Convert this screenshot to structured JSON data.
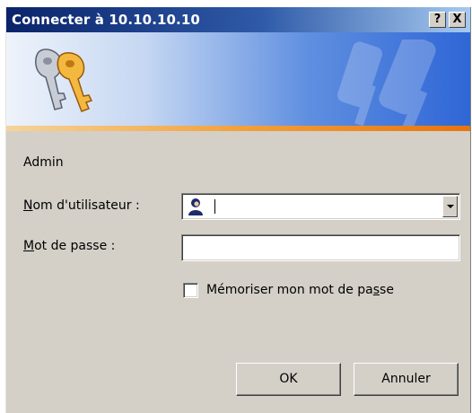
{
  "window": {
    "title": "Connecter à 10.10.10.10",
    "help_label": "?",
    "close_label": "X"
  },
  "banner": {
    "icon": "keys-icon",
    "watermark_icon": "keys-watermark-icon"
  },
  "realm_text": "Admin",
  "username": {
    "label_accel": "N",
    "label_rest": "om d'utilisateur :",
    "value": "",
    "icon": "user-icon"
  },
  "password": {
    "label_accel": "M",
    "label_rest": "ot de passe :",
    "value": ""
  },
  "remember": {
    "label_before": "Mémoriser mon mot de pa",
    "label_accel": "s",
    "label_after": "se",
    "checked": false
  },
  "buttons": {
    "ok_label": "OK",
    "cancel_label": "Annuler"
  },
  "colors": {
    "title_bar_start": "#0a246a",
    "title_bar_end": "#a6caf0",
    "dialog_face": "#d4d0c8",
    "banner_stripe": "#f2a13c"
  }
}
